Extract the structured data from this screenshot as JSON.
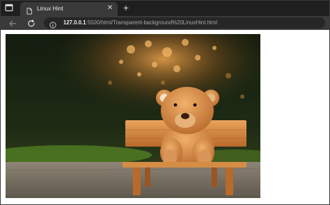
{
  "tab": {
    "title": "Linux Hint",
    "close_glyph": "✕",
    "favicon": "page-icon"
  },
  "new_tab_glyph": "+",
  "icons": {
    "tab_actions": "window-icon",
    "back": "back-arrow-icon",
    "reload": "reload-icon",
    "site_info": "info-icon"
  },
  "address": {
    "host": "127.0.0.1",
    "path": ":5500/html/Transparent-background%20LinuxHint.html"
  },
  "image": {
    "subject": "teddy-bear-on-bench"
  },
  "colors": {
    "tabstrip": "#1f1f1f",
    "toolbar": "#3a3a3a",
    "omnibox": "#262626",
    "page": "#ffffff"
  }
}
